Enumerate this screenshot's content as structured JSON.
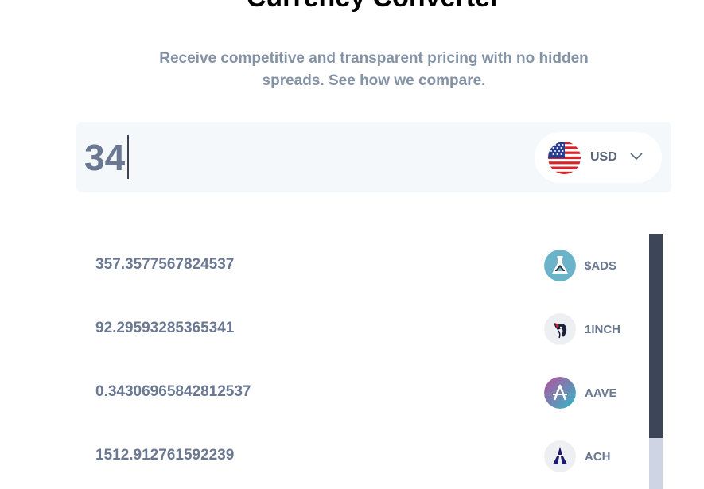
{
  "header": {
    "title": "Currency Converter",
    "subtitle_line1": "Receive competitive and transparent pricing with no hidden",
    "subtitle_line2": "spreads. See how we compare."
  },
  "converter": {
    "amount": "34",
    "currency": {
      "code": "USD",
      "icon": "us-flag-icon"
    }
  },
  "results": [
    {
      "value": "357.3577567824537",
      "symbol": "$ADS",
      "icon": "ads-flask-icon"
    },
    {
      "value": "92.29593285365341",
      "symbol": "1INCH",
      "icon": "1inch-unicorn-icon"
    },
    {
      "value": "0.34306965842812537",
      "symbol": "AAVE",
      "icon": "aave-icon"
    },
    {
      "value": "1512.912761592239",
      "symbol": "ACH",
      "icon": "ach-icon"
    }
  ],
  "colors": {
    "text_muted": "#6b7891",
    "panel_bg": "#f5f8fb",
    "scroll_thumb": "#3c4658",
    "scroll_track": "#ced4e4"
  }
}
